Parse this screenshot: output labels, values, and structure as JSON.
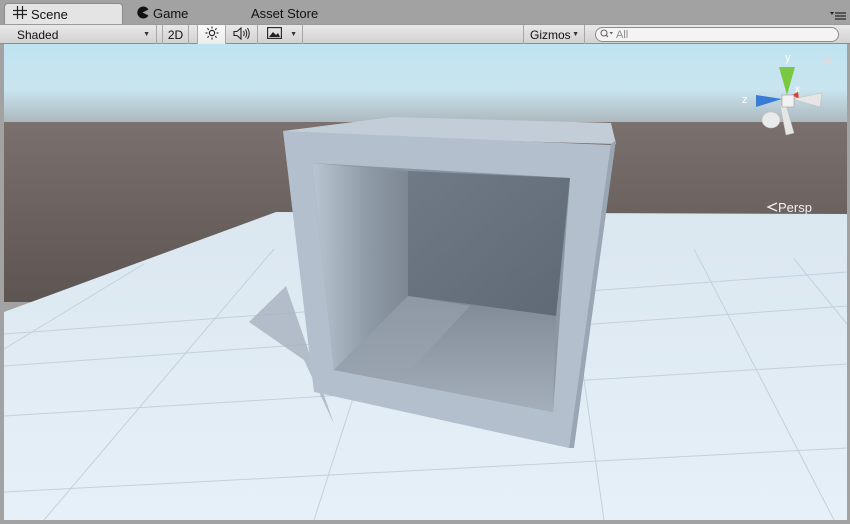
{
  "tabs": [
    {
      "label": "Scene",
      "icon": "grid-icon"
    },
    {
      "label": "Game",
      "icon": "pacman-icon"
    },
    {
      "label": "Asset Store",
      "icon": ""
    }
  ],
  "toolbar": {
    "shading_mode": "Shaded",
    "mode_2d": "2D",
    "gizmos": "Gizmos",
    "search_placeholder": "All"
  },
  "gizmo": {
    "axis_y": "y",
    "axis_x": "x",
    "axis_z": "z",
    "projection": "Persp",
    "colors": {
      "y": "#7ac943",
      "x": "#e83b2a",
      "z": "#3a7bd5"
    }
  },
  "scene": {
    "sky_color": "#b4dceb",
    "ground_color": "#5f5754",
    "plane_color": "#e1edf6",
    "cube_color": "#b3bfcc"
  }
}
